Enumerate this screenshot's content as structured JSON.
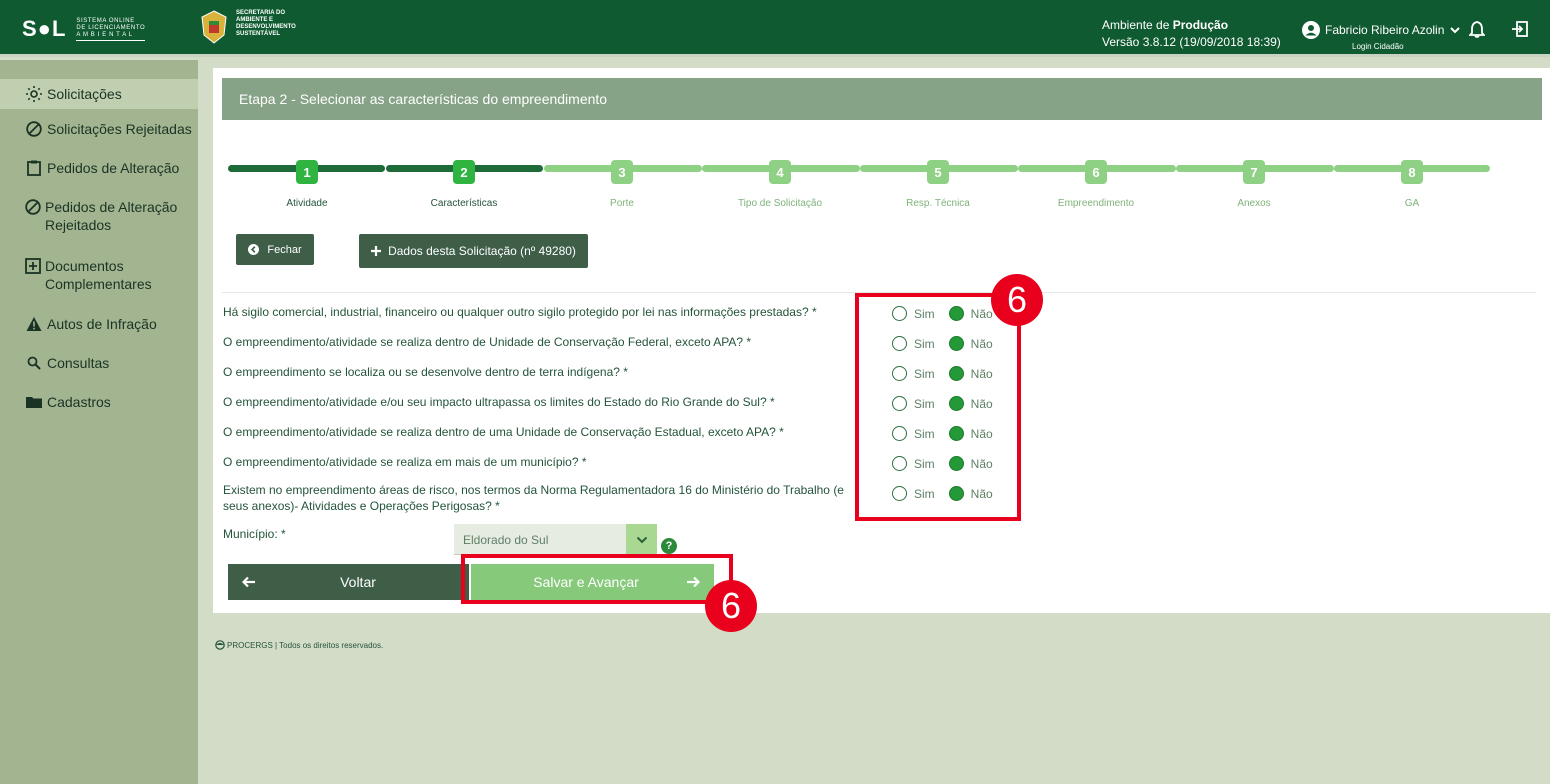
{
  "header": {
    "logo_big": "S●L",
    "logo_small_1": "SISTEMA ONLINE",
    "logo_small_2": "DE LICENCIAMENTO",
    "logo_small_3": "A M B I E N T A L",
    "secretaria_1": "SECRETARIA DO",
    "secretaria_2": "AMBIENTE E",
    "secretaria_3": "DESENVOLVIMENTO",
    "secretaria_4": "SUSTENTÁVEL",
    "env_prefix": "Ambiente de ",
    "env_name": "Produção",
    "version": "Versão 3.8.12 (19/09/2018 18:39)",
    "user_name": "Fabricio Ribeiro Azolin",
    "login_type": "Login Cidadão",
    "icons": [
      "user-icon",
      "chevron-down-icon",
      "bell-icon",
      "logout-icon"
    ]
  },
  "sidebar": {
    "items": [
      {
        "label": "Solicitações",
        "icon": "sun-icon"
      },
      {
        "label": "Solicitações Rejeitadas",
        "icon": "forbidden-icon"
      },
      {
        "label": "Pedidos de Alteração",
        "icon": "clipboard-icon"
      },
      {
        "label": "Pedidos de Alteração Rejeitados",
        "icon": "forbidden-icon"
      },
      {
        "label": "Documentos Complementares",
        "icon": "plus-box-icon"
      },
      {
        "label": "Autos de Infração",
        "icon": "warning-icon"
      },
      {
        "label": "Consultas",
        "icon": "search-icon"
      },
      {
        "label": "Cadastros",
        "icon": "folder-icon"
      }
    ]
  },
  "main": {
    "stage_title": "Etapa 2 - Selecionar as características do empreendimento",
    "steps": [
      {
        "num": "1",
        "label": "Atividade",
        "state": "done"
      },
      {
        "num": "2",
        "label": "Características",
        "state": "done"
      },
      {
        "num": "3",
        "label": "Porte",
        "state": "todo"
      },
      {
        "num": "4",
        "label": "Tipo de Solicitação",
        "state": "todo"
      },
      {
        "num": "5",
        "label": "Resp. Técnica",
        "state": "todo"
      },
      {
        "num": "6",
        "label": "Empreendimento",
        "state": "todo"
      },
      {
        "num": "7",
        "label": "Anexos",
        "state": "todo"
      },
      {
        "num": "8",
        "label": "GA",
        "state": "todo"
      }
    ],
    "close_label": "Fechar",
    "request_data_label": "Dados desta Solicitação (nº 49280)",
    "radio_yes": "Sim",
    "radio_no": "Não",
    "questions": [
      "Há sigilo comercial, industrial, financeiro ou qualquer outro sigilo protegido por lei nas informações prestadas? *",
      "O empreendimento/atividade se realiza dentro de Unidade de Conservação Federal, exceto APA? *",
      "O empreendimento se localiza ou se desenvolve dentro de terra indígena? *",
      "O empreendimento/atividade e/ou seu impacto ultrapassa os limites do Estado do Rio Grande do Sul? *",
      "O empreendimento/atividade se realiza dentro de uma Unidade de Conservação Estadual, exceto APA? *",
      "O empreendimento/atividade se realiza em mais de um município? *",
      "Existem no empreendimento áreas de risco, nos termos da Norma Regulamentadora 16 do Ministério do Trabalho (e seus anexos)- Atividades e Operações Perigosas? *"
    ],
    "municipio_label": "Município:  *",
    "municipio_value": "Eldorado do Sul",
    "help_glyph": "?",
    "back_label": "Voltar",
    "save_label": "Salvar e Avançar"
  },
  "footer": {
    "text": "PROCERGS | Todos os direitos reservados."
  },
  "annotations": {
    "badge_1": "6",
    "badge_2": "6",
    "color": "#e8001c"
  }
}
